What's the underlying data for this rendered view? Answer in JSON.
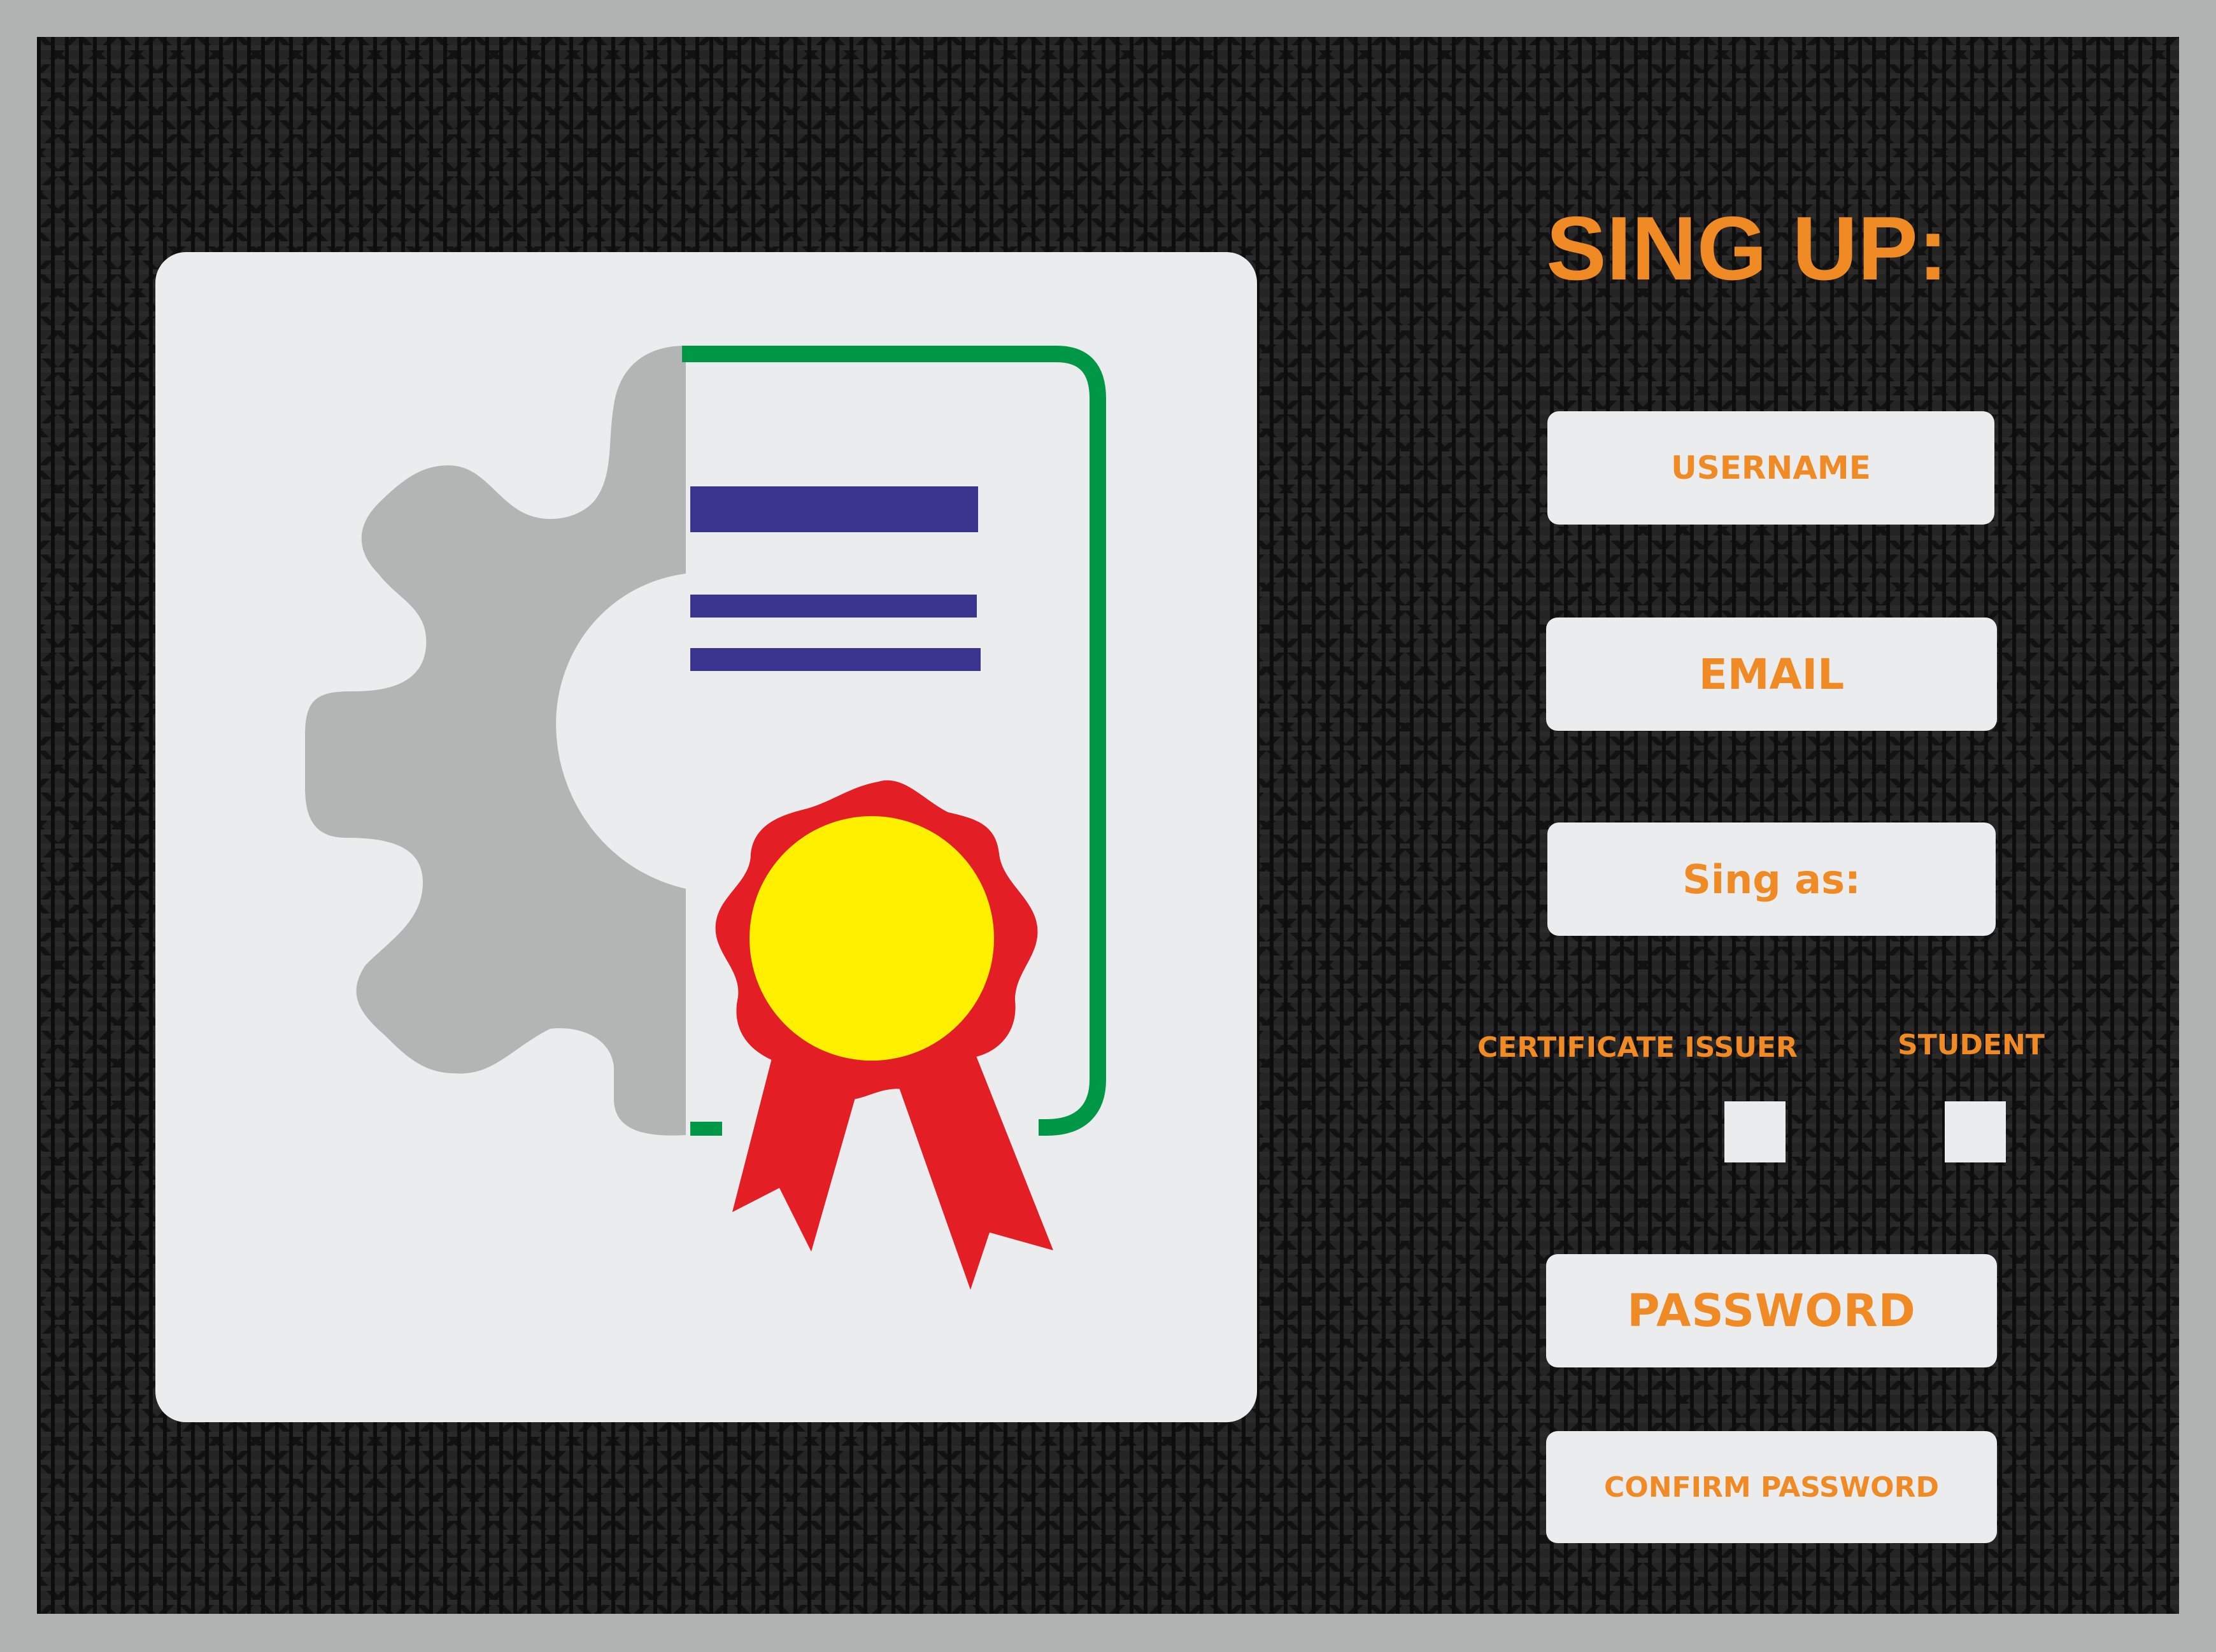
{
  "form": {
    "title": "SING UP:",
    "username_placeholder": "USERNAME",
    "email_placeholder": "EMAIL",
    "sign_as_label": "Sing as:",
    "roles": [
      {
        "label": "CERTIFICATE ISSUER",
        "checked": false
      },
      {
        "label": "STUDENT",
        "checked": false
      }
    ],
    "password_placeholder": "PASSWORD",
    "confirm_password_placeholder": "CONFIRM PASSWORD"
  },
  "illustration": {
    "icon": "certificate-with-gear-icon",
    "colors": {
      "gear": "#b3b4b4",
      "document_border": "#009846",
      "text_lines": "#3c3590",
      "ribbon": "#e31e24",
      "medal": "#fff000"
    }
  },
  "colors": {
    "accent": "#f08a24",
    "field_background": "#ebeced",
    "frame": "#b1b3b2",
    "screen_background": "#242424"
  }
}
